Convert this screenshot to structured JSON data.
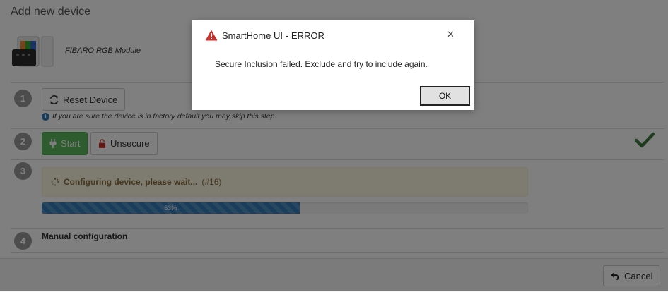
{
  "page": {
    "title": "Add new device",
    "device_name": "FIBARO RGB Module"
  },
  "steps": [
    {
      "number": "1"
    },
    {
      "number": "2"
    },
    {
      "number": "3"
    },
    {
      "number": "4"
    }
  ],
  "step1": {
    "reset_button_label": "Reset Device",
    "reset_icon": "refresh-icon",
    "hint_icon": "info-icon",
    "hint": "If you are sure the device is in factory default you may skip this step."
  },
  "step2": {
    "start_button_label": "Start",
    "start_icon": "plug-icon",
    "unsecure_button_label": "Unsecure",
    "unsecure_icon": "unlock-icon",
    "status_icon": "checkmark-icon",
    "status_color": "#3c763d"
  },
  "step3": {
    "status_bold": "Configuring device, please wait...",
    "status_suffix": "(#16)",
    "spinner_icon": "spinner-icon",
    "progress_percent": 53,
    "progress_label": "53%"
  },
  "step4": {
    "title": "Manual configuration"
  },
  "footer": {
    "cancel_label": "Cancel",
    "cancel_icon": "undo-icon"
  },
  "dialog": {
    "title_normal": "SmartHome UI",
    "title_bold": "- ERROR",
    "warning_icon": "warning-icon",
    "warning_color": "#c9302c",
    "close_icon": "close-icon",
    "message": "Secure Inclusion failed. Exclude and try to include again.",
    "ok_label": "OK"
  },
  "colors": {
    "primary": "#337ab7",
    "success": "#5cb85c",
    "warning_bg": "#fcf8e3",
    "warning_text": "#8a6d3b"
  }
}
